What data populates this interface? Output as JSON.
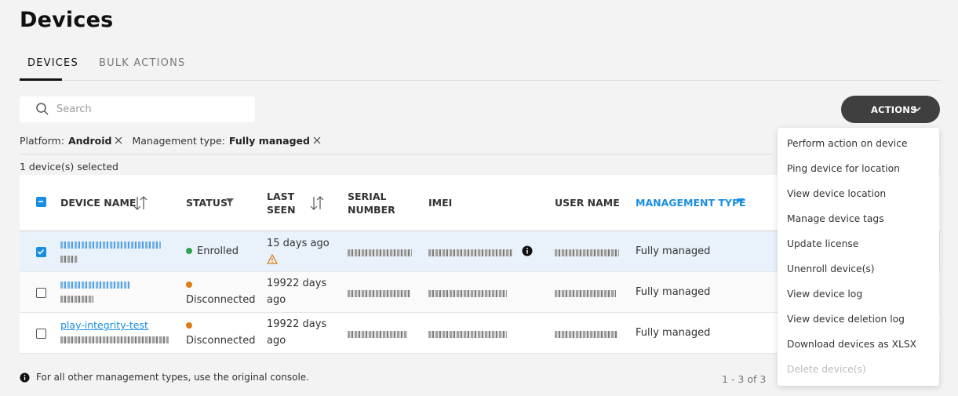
{
  "page": {
    "title": "Devices"
  },
  "tabs": [
    {
      "label": "DEVICES"
    },
    {
      "label": "BULK ACTIONS"
    }
  ],
  "search": {
    "placeholder": "Search"
  },
  "actions_button": {
    "label": "ACTIONS"
  },
  "filters": {
    "platform_label": "Platform:",
    "platform_value": "Android",
    "mgmt_label": "Management type:",
    "mgmt_value": "Fully managed"
  },
  "selection_text": "1 device(s) selected",
  "columns": {
    "device_name": "DEVICE NAME",
    "status": "STATUS",
    "last_seen_1": "LAST",
    "last_seen_2": "SEEN",
    "serial_1": "SERIAL",
    "serial_2": "NUMBER",
    "imei": "IMEI",
    "user_name": "USER NAME",
    "management_type": "MANAGEMENT TYPE"
  },
  "rows": [
    {
      "name_visible": "",
      "status": "Enrolled",
      "status_color": "#2ea44f",
      "last_seen_1": "15 days ago",
      "last_seen_2": "",
      "management": "Fully managed"
    },
    {
      "name_visible": "",
      "status": "Disconnected",
      "status_color": "#e07b1a",
      "last_seen_1": "19922 days",
      "last_seen_2": "ago",
      "management": "Fully managed"
    },
    {
      "name_visible": "play-integrity-test",
      "status": "Disconnected",
      "status_color": "#e07b1a",
      "last_seen_1": "19922 days",
      "last_seen_2": "ago",
      "management": "Fully managed"
    }
  ],
  "menu": {
    "items": [
      "Perform action on device",
      "Ping device for location",
      "View device location",
      "Manage device tags",
      "Update license",
      "Unenroll device(s)",
      "View device log",
      "View device deletion log",
      "Download devices as XLSX",
      "Delete device(s)"
    ]
  },
  "footer": {
    "note": "For all other management types, use the original console.",
    "pager": "1 - 3 of 3"
  },
  "colors": {
    "accent": "#1a8ee0",
    "enrolled": "#2ea44f",
    "disconnected": "#e07b1a"
  }
}
